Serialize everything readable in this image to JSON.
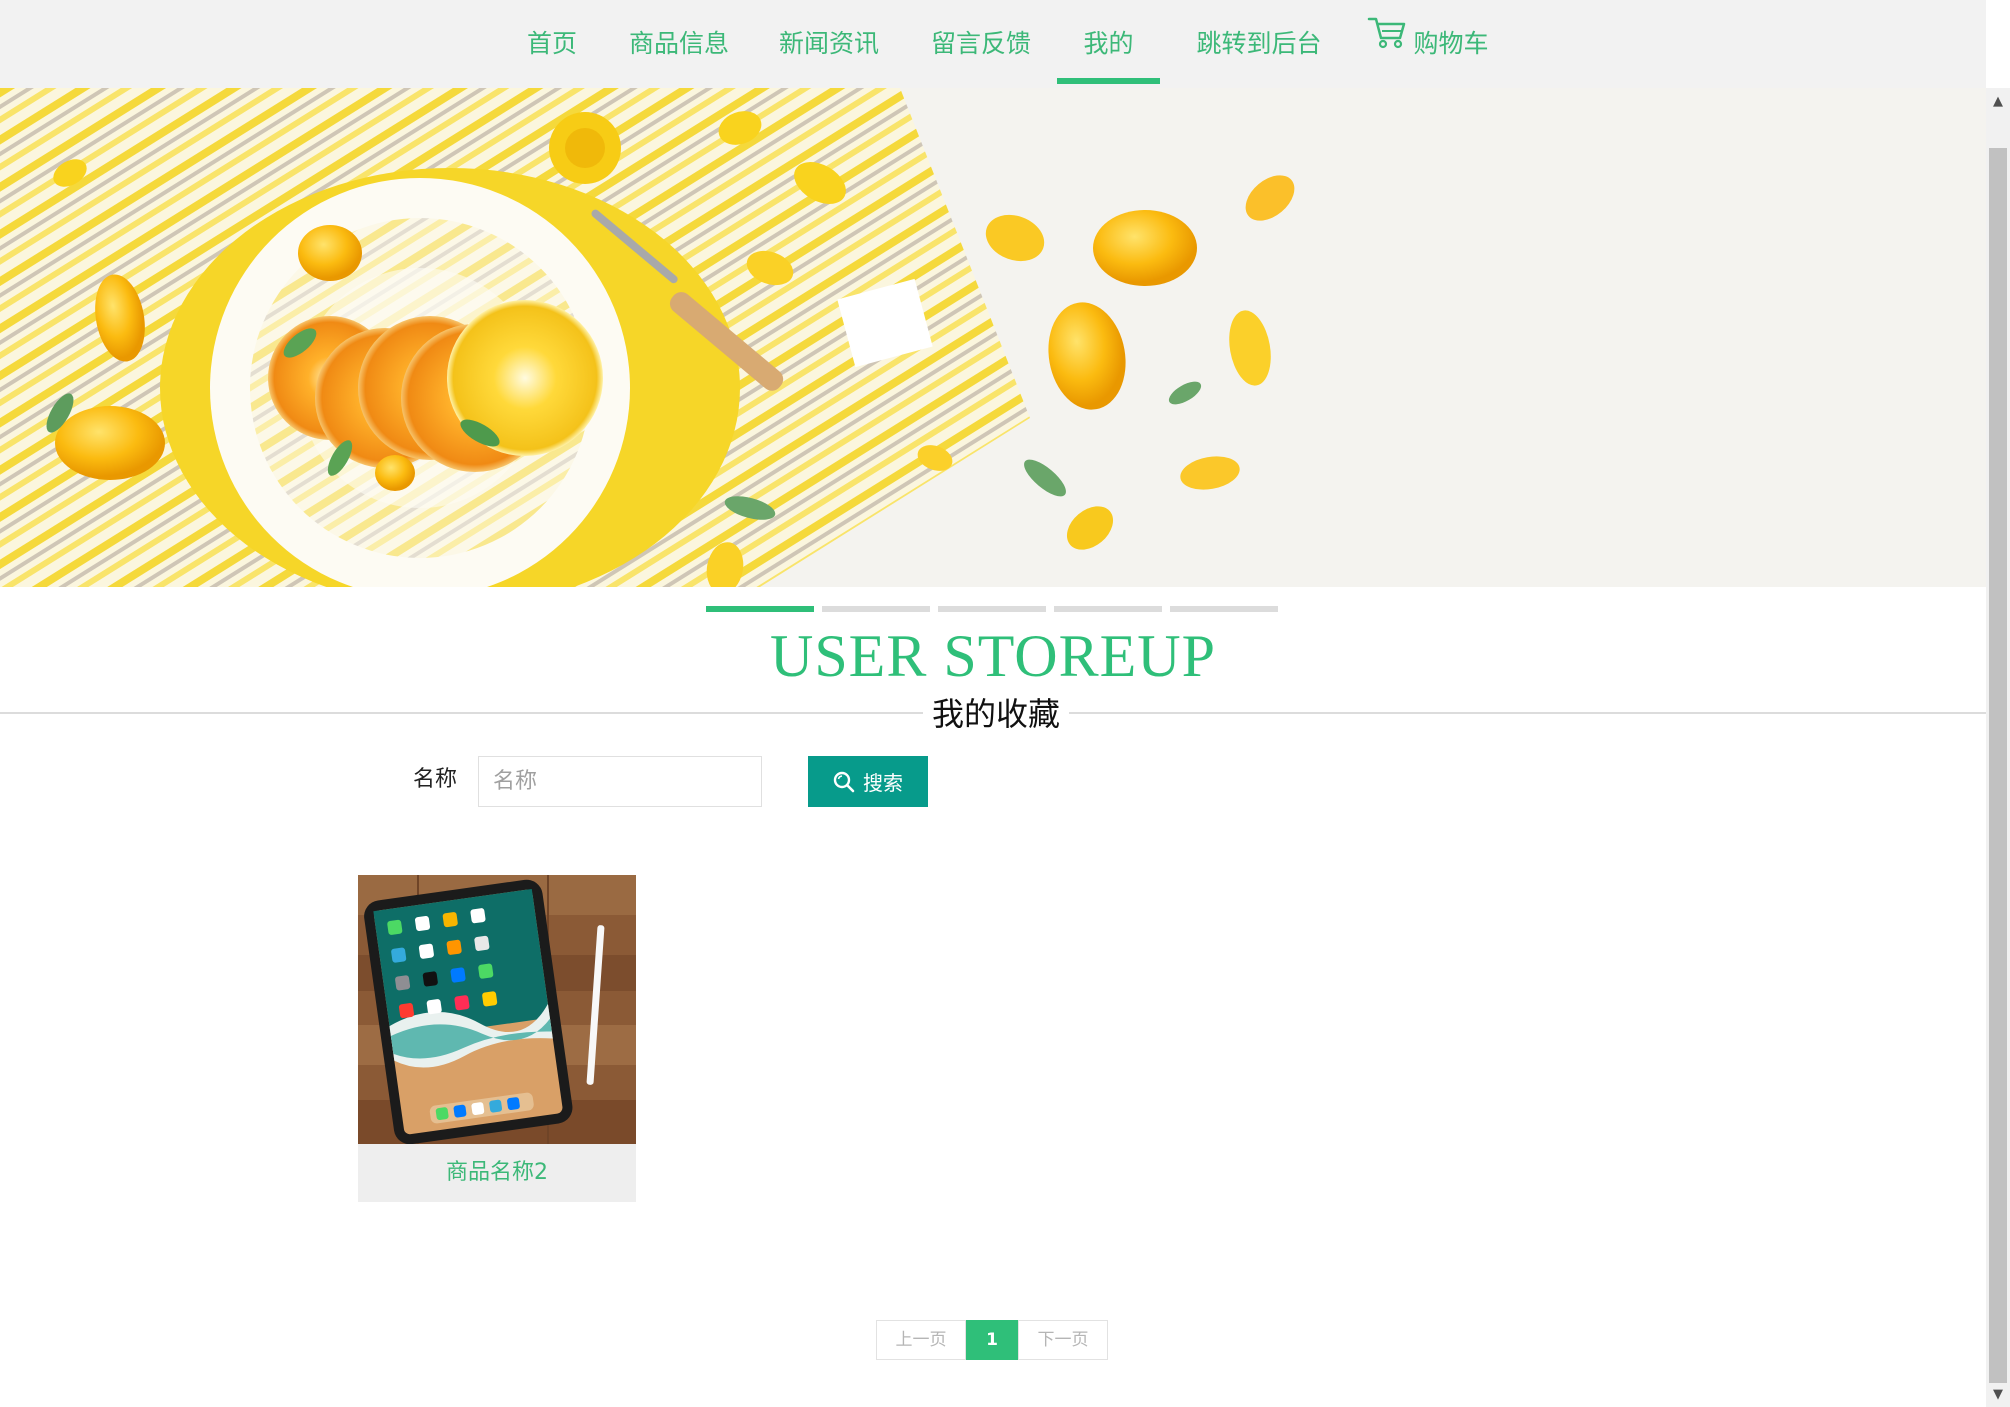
{
  "nav": {
    "items": [
      {
        "label": "首页"
      },
      {
        "label": "商品信息"
      },
      {
        "label": "新闻资讯"
      },
      {
        "label": "留言反馈"
      },
      {
        "label": "我的",
        "active": true
      },
      {
        "label": "跳转到后台"
      }
    ],
    "cart_label": "购物车",
    "cart_icon": "cart-icon"
  },
  "carousel": {
    "slide_count": 5,
    "active_index": 0
  },
  "section": {
    "title_en": "USER STOREUP",
    "title_cn": "我的收藏"
  },
  "search": {
    "label": "名称",
    "placeholder": "名称",
    "value": "",
    "button_label": "搜索",
    "button_icon": "search-icon"
  },
  "products": [
    {
      "name": "商品名称2"
    }
  ],
  "pagination": {
    "prev_label": "上一页",
    "current_page": "1",
    "next_label": "下一页"
  },
  "colors": {
    "accent": "#2fbf79",
    "search_button": "#079b8b",
    "nav_bg": "#f2f2f2"
  }
}
